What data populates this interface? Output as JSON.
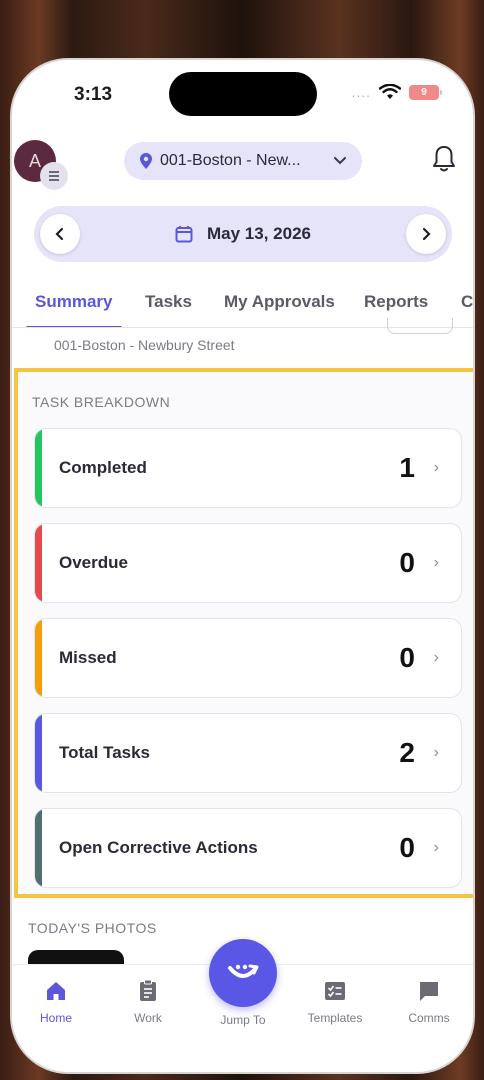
{
  "status_bar": {
    "time": "3:13",
    "signal_dots": "....",
    "battery_level": "9"
  },
  "header": {
    "avatar_initial": "A",
    "location": "001-Boston - New...",
    "has_notifications": true
  },
  "date_bar": {
    "date": "May 13, 2026"
  },
  "tabs": [
    {
      "label": "Summary",
      "active": true
    },
    {
      "label": "Tasks"
    },
    {
      "label": "My Approvals"
    },
    {
      "label": "Reports"
    },
    {
      "label": "C"
    }
  ],
  "scroll_peek": {
    "location_text": "001-Boston - Newbury Street"
  },
  "task_breakdown": {
    "title": "TASK BREAKDOWN",
    "items": [
      {
        "label": "Completed",
        "value": "1",
        "color": "#22c55e"
      },
      {
        "label": "Overdue",
        "value": "0",
        "color": "#e5484d"
      },
      {
        "label": "Missed",
        "value": "0",
        "color": "#f59e0b"
      },
      {
        "label": "Total Tasks",
        "value": "2",
        "color": "#5b57e6"
      },
      {
        "label": "Open Corrective Actions",
        "value": "0",
        "color": "#4f6f73"
      }
    ]
  },
  "photos": {
    "title": "TODAY'S PHOTOS"
  },
  "nav": {
    "items": [
      {
        "label": "Home",
        "icon": "home-icon",
        "active": true
      },
      {
        "label": "Work",
        "icon": "clipboard-icon"
      },
      {
        "label": "Jump To",
        "icon": "jump-icon"
      },
      {
        "label": "Templates",
        "icon": "templates-icon"
      },
      {
        "label": "Comms",
        "icon": "chat-icon"
      }
    ]
  },
  "colors": {
    "accent": "#5b57d9",
    "highlight_border": "#f2c542"
  }
}
